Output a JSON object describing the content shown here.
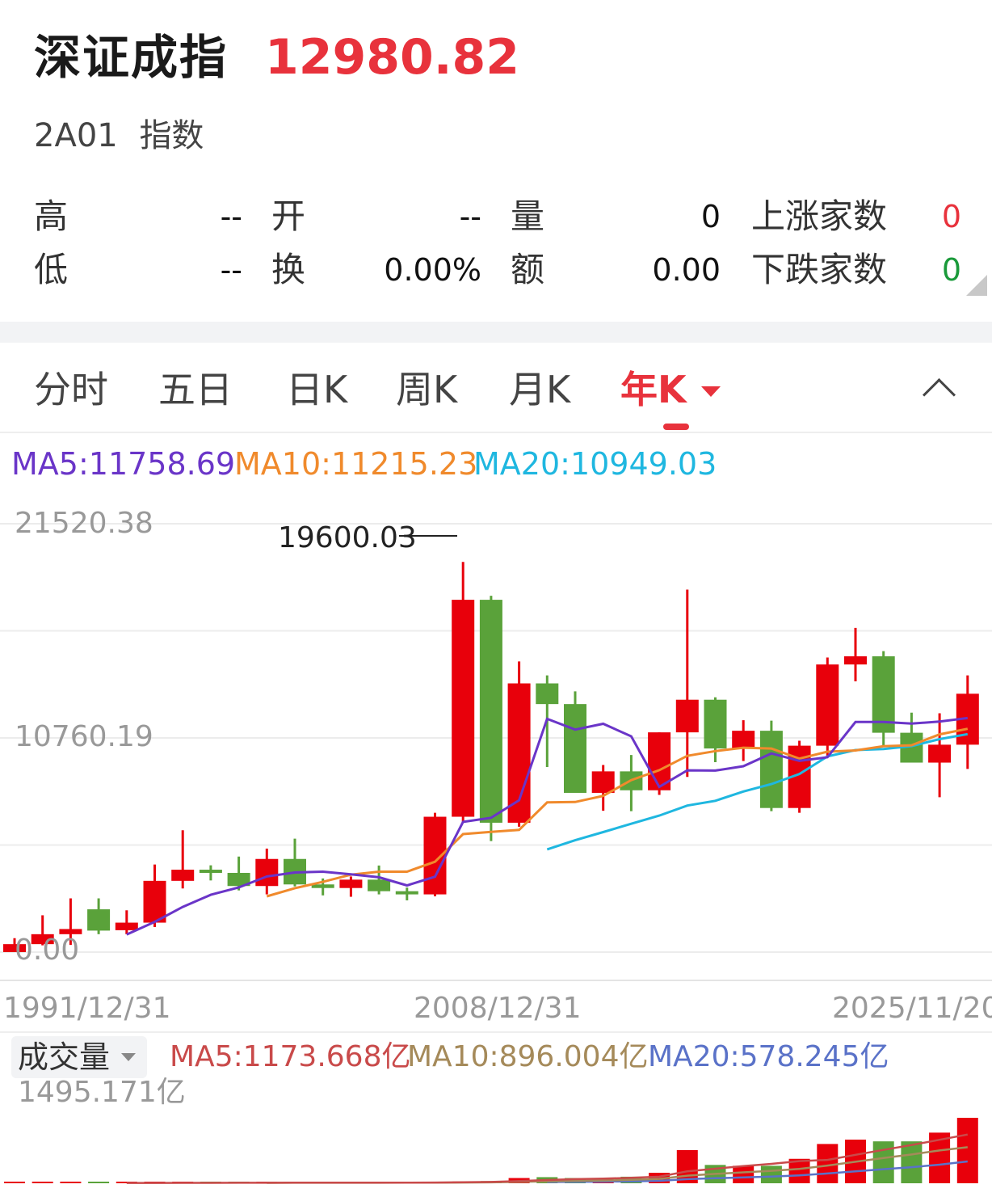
{
  "header": {
    "name": "深证成指",
    "price": "12980.82",
    "code": "2A01",
    "category": "指数"
  },
  "stats": {
    "high_label": "高",
    "high_value": "--",
    "open_label": "开",
    "open_value": "--",
    "volume_label": "量",
    "volume_value": "0",
    "up_label": "上涨家数",
    "up_value": "0",
    "low_label": "低",
    "low_value": "--",
    "turnover_label": "换",
    "turnover_value": "0.00%",
    "amount_label": "额",
    "amount_value": "0.00",
    "down_label": "下跌家数",
    "down_value": "0"
  },
  "tabs": [
    {
      "label": "分时",
      "active": false
    },
    {
      "label": "五日",
      "active": false
    },
    {
      "label": "日K",
      "active": false
    },
    {
      "label": "周K",
      "active": false
    },
    {
      "label": "月K",
      "active": false
    },
    {
      "label": "年K",
      "active": true
    }
  ],
  "ma_legend": {
    "ma5": "MA5:11758.69",
    "ma10": "MA10:11215.23",
    "ma20": "MA20:10949.03"
  },
  "price_axis": {
    "top": "21520.38",
    "mid": "10760.19",
    "bottom": "0.00",
    "peak_annotation": "19600.03"
  },
  "date_axis": {
    "start": "1991/12/31",
    "mid": "2008/12/31",
    "end": "2025/11/20"
  },
  "volume": {
    "title": "成交量",
    "ma5": "MA5:1173.668亿",
    "ma10": "MA10:896.004亿",
    "ma20": "MA20:578.245亿",
    "top": "1495.171亿"
  },
  "colors": {
    "up": "#e8000b",
    "down": "#5aa23a",
    "ma5": "#6a35c8",
    "ma10": "#f08a2c",
    "ma20": "#1fb7e0",
    "vol_ma5": "#c94a4a",
    "vol_ma10": "#a58a5a",
    "vol_ma20": "#5a72c8"
  },
  "chart_data": {
    "type": "candlestick",
    "years": [
      1991,
      1992,
      1993,
      1994,
      1995,
      1996,
      1997,
      1998,
      1999,
      2000,
      2001,
      2002,
      2003,
      2004,
      2005,
      2006,
      2007,
      2008,
      2009,
      2010,
      2011,
      2012,
      2013,
      2014,
      2015,
      2016,
      2017,
      2018,
      2019,
      2020,
      2021,
      2022,
      2023,
      2024,
      2025
    ],
    "open": [
      0,
      400,
      900,
      2150,
      1100,
      1480,
      3580,
      4140,
      3980,
      3320,
      4680,
      3400,
      3220,
      3640,
      3060,
      2900,
      6800,
      17700,
      6500,
      13500,
      12460,
      8000,
      9080,
      8130,
      11040,
      12680,
      10230,
      11120,
      7240,
      10370,
      14450,
      14860,
      11020,
      9520,
      10420
    ],
    "close": [
      400,
      900,
      1160,
      1080,
      1480,
      3580,
      4140,
      3980,
      3320,
      4680,
      3400,
      3220,
      3640,
      3060,
      2900,
      6800,
      17700,
      6500,
      13500,
      12460,
      8000,
      9080,
      8130,
      11040,
      12680,
      10230,
      11120,
      7240,
      10370,
      14450,
      14860,
      11020,
      9520,
      10420,
      12980
    ],
    "high": [
      700,
      1850,
      2700,
      2700,
      2100,
      4400,
      6120,
      4360,
      4800,
      5200,
      5700,
      3700,
      3800,
      4350,
      3240,
      7000,
      19600,
      17900,
      14600,
      13900,
      13100,
      9400,
      9900,
      11040,
      18210,
      12800,
      11650,
      11630,
      10620,
      14800,
      16290,
      15120,
      12030,
      12000,
      13900
    ],
    "low": [
      0,
      340,
      360,
      900,
      900,
      1260,
      3200,
      3600,
      3100,
      2900,
      3300,
      2850,
      2780,
      2900,
      2600,
      2800,
      6500,
      5580,
      6300,
      9300,
      8600,
      7100,
      7080,
      7900,
      8800,
      9540,
      9600,
      7080,
      7000,
      9800,
      13600,
      10300,
      9600,
      7780,
      9200
    ],
    "ma5": [
      null,
      null,
      null,
      null,
      880,
      1520,
      2270,
      2880,
      3250,
      3800,
      4000,
      4040,
      3910,
      3760,
      3350,
      3790,
      6540,
      6750,
      7630,
      11720,
      11180,
      11470,
      10840,
      8300,
      9130,
      9120,
      9340,
      9980,
      9610,
      9790,
      11560,
      11560,
      11480,
      11580,
      11760
    ],
    "ma10": [
      null,
      null,
      null,
      null,
      null,
      null,
      null,
      null,
      null,
      2800,
      3210,
      3530,
      3890,
      4040,
      4040,
      4540,
      5930,
      6040,
      6140,
      7520,
      7540,
      7850,
      8640,
      9140,
      9860,
      10100,
      10270,
      10230,
      9720,
      10070,
      10130,
      10340,
      10390,
      10940,
      11220
    ],
    "ma20": [
      null,
      null,
      null,
      null,
      null,
      null,
      null,
      null,
      null,
      null,
      null,
      null,
      null,
      null,
      null,
      null,
      null,
      null,
      null,
      5160,
      5620,
      6030,
      6450,
      6860,
      7360,
      7600,
      8070,
      8440,
      8950,
      9830,
      10150,
      10200,
      10350,
      10700,
      10950
    ],
    "volume_bar_fraction": [
      0.003,
      0.003,
      0.004,
      0.004,
      0.004,
      0.005,
      0.006,
      0.006,
      0.006,
      0.007,
      0.006,
      0.006,
      0.007,
      0.007,
      0.008,
      0.012,
      0.02,
      0.025,
      0.06,
      0.07,
      0.06,
      0.05,
      0.075,
      0.12,
      0.38,
      0.21,
      0.2,
      0.2,
      0.28,
      0.45,
      0.5,
      0.48,
      0.48,
      0.58,
      0.75
    ],
    "y_range": [
      0,
      21520.38
    ]
  }
}
